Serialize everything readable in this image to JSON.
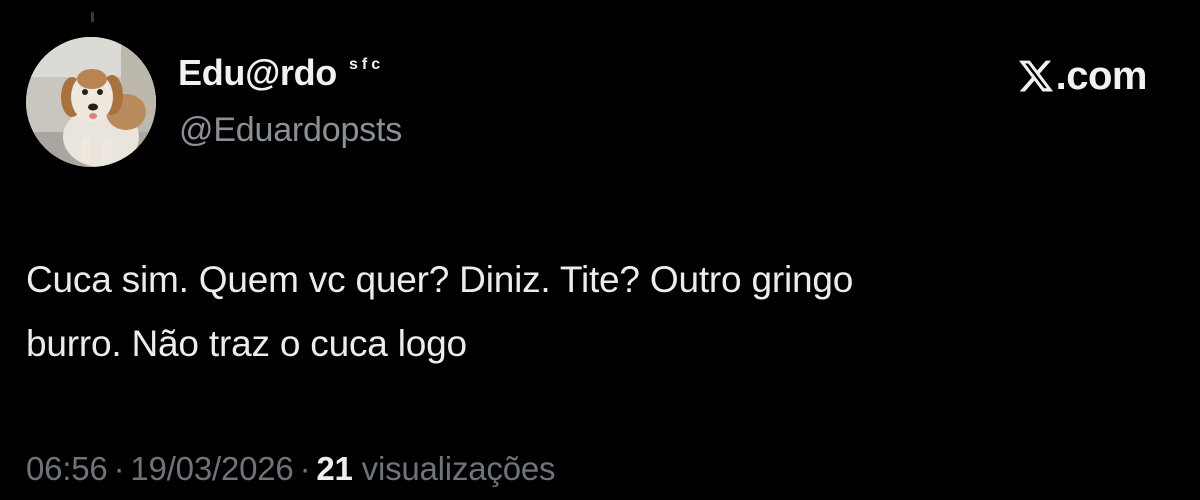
{
  "author": {
    "display_name": "Edu@rdo",
    "name_suffix": "sfc",
    "handle": "@Eduardopsts",
    "avatar_icon": "dog-avatar"
  },
  "brand": {
    "domain_text": ".com",
    "icon": "x-logo-icon"
  },
  "tweet": {
    "lines": [
      "Cuca sim. Quem vc quer? Diniz. Tite? Outro gringo",
      "burro. Não traz o cuca logo"
    ]
  },
  "meta": {
    "time": "06:56",
    "separator": "·",
    "date": "19/03/2026",
    "views_count": "21",
    "views_label": "visualizações"
  },
  "colors": {
    "background": "#000000",
    "primary_text": "#e7e9ea",
    "secondary_text": "#6f747a"
  }
}
